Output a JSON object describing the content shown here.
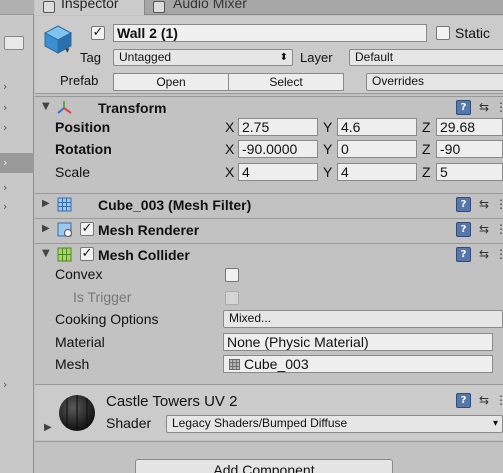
{
  "tabs": {
    "inspector": "Inspector",
    "audio_mixer": "Audio Mixer"
  },
  "header": {
    "active": true,
    "object_name": "Wall 2 (1)",
    "static_label": "Static",
    "static_checked": false,
    "tag_label": "Tag",
    "tag_value": "Untagged",
    "layer_label": "Layer",
    "layer_value": "Default",
    "prefab_label": "Prefab",
    "open_button": "Open",
    "select_button": "Select",
    "overrides": "Overrides"
  },
  "transform": {
    "title": "Transform",
    "position_label": "Position",
    "rotation_label": "Rotation",
    "scale_label": "Scale",
    "position": {
      "x": "2.75",
      "y": "4.6",
      "z": "29.68"
    },
    "rotation": {
      "x": "-90.0000",
      "y": "0",
      "z": "-90"
    },
    "scale": {
      "x": "4",
      "y": "4",
      "z": "5"
    },
    "axis_x": "X",
    "axis_y": "Y",
    "axis_z": "Z"
  },
  "mesh_filter": {
    "title": "Cube_003 (Mesh Filter)"
  },
  "mesh_renderer": {
    "title": "Mesh Renderer",
    "enabled": true
  },
  "mesh_collider": {
    "title": "Mesh Collider",
    "enabled": true,
    "convex_label": "Convex",
    "convex": false,
    "is_trigger_label": "Is Trigger",
    "is_trigger": false,
    "cooking_label": "Cooking Options",
    "cooking_value": "Mixed...",
    "material_label": "Material",
    "material_value": "None (Physic Material)",
    "mesh_label": "Mesh",
    "mesh_value": "Cube_003"
  },
  "material": {
    "name": "Castle Towers UV 2",
    "shader_label": "Shader",
    "shader_value": "Legacy Shaders/Bumped Diffuse"
  },
  "add_component": "Add Component",
  "colors": {
    "panel": "#c2c2c2",
    "header": "#cbcbcb",
    "field": "#eeeeee",
    "help_icon": "#5577aa"
  }
}
